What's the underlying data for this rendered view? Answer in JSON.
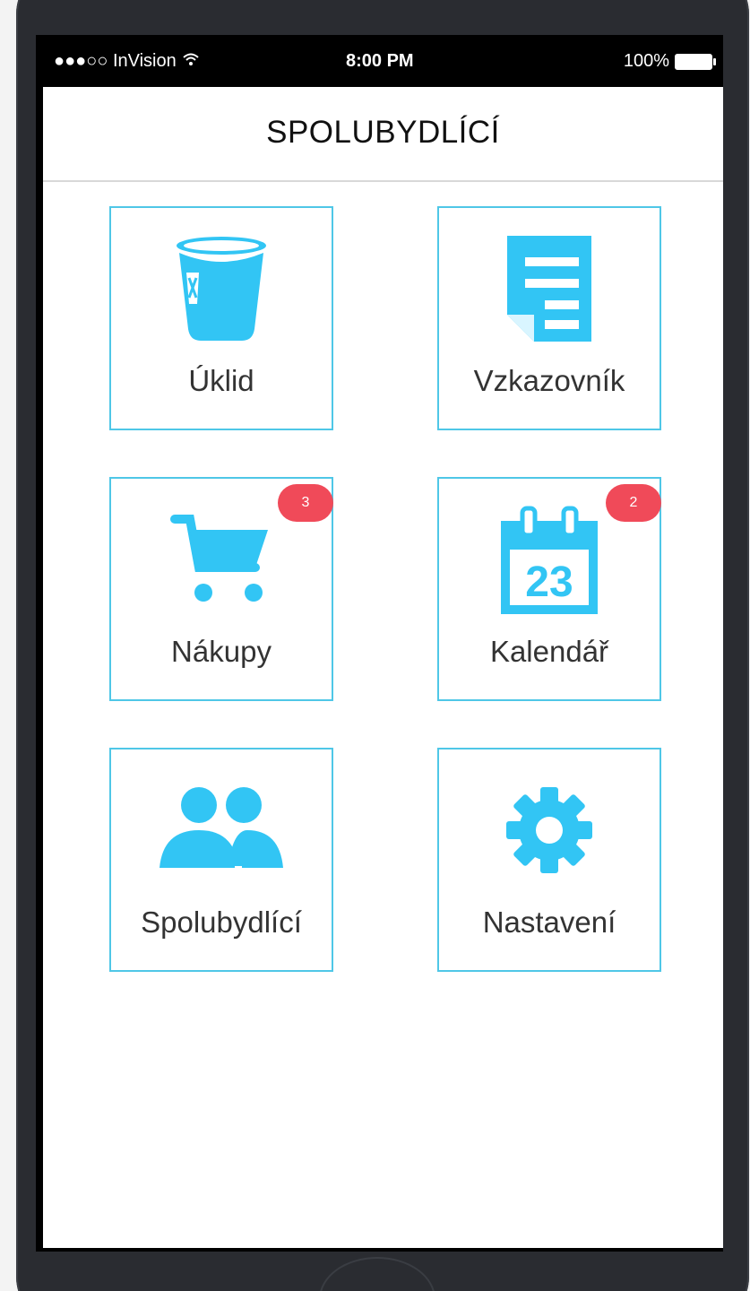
{
  "status_bar": {
    "carrier": "●●●○○ InVision",
    "wifi_icon": "wifi-icon",
    "time": "8:00 PM",
    "battery": "100%"
  },
  "header": {
    "title": "SPOLUBYDLÍCÍ"
  },
  "tiles": [
    {
      "label": "Úklid",
      "icon": "trash-bin-icon",
      "badge": ""
    },
    {
      "label": "Vzkazovník",
      "icon": "note-icon",
      "badge": ""
    },
    {
      "label": "Nákupy",
      "icon": "cart-icon",
      "badge": "3"
    },
    {
      "label": "Kalendář",
      "icon": "calendar-icon",
      "badge": "2",
      "calendar_number": "23"
    },
    {
      "label": "Spolubydlící",
      "icon": "people-icon",
      "badge": ""
    },
    {
      "label": "Nastavení",
      "icon": "gear-icon",
      "badge": ""
    }
  ],
  "colors": {
    "accent": "#4fc7e7",
    "icon": "#32c5f4",
    "badge": "#f04a59",
    "device": "#2a2c31"
  }
}
